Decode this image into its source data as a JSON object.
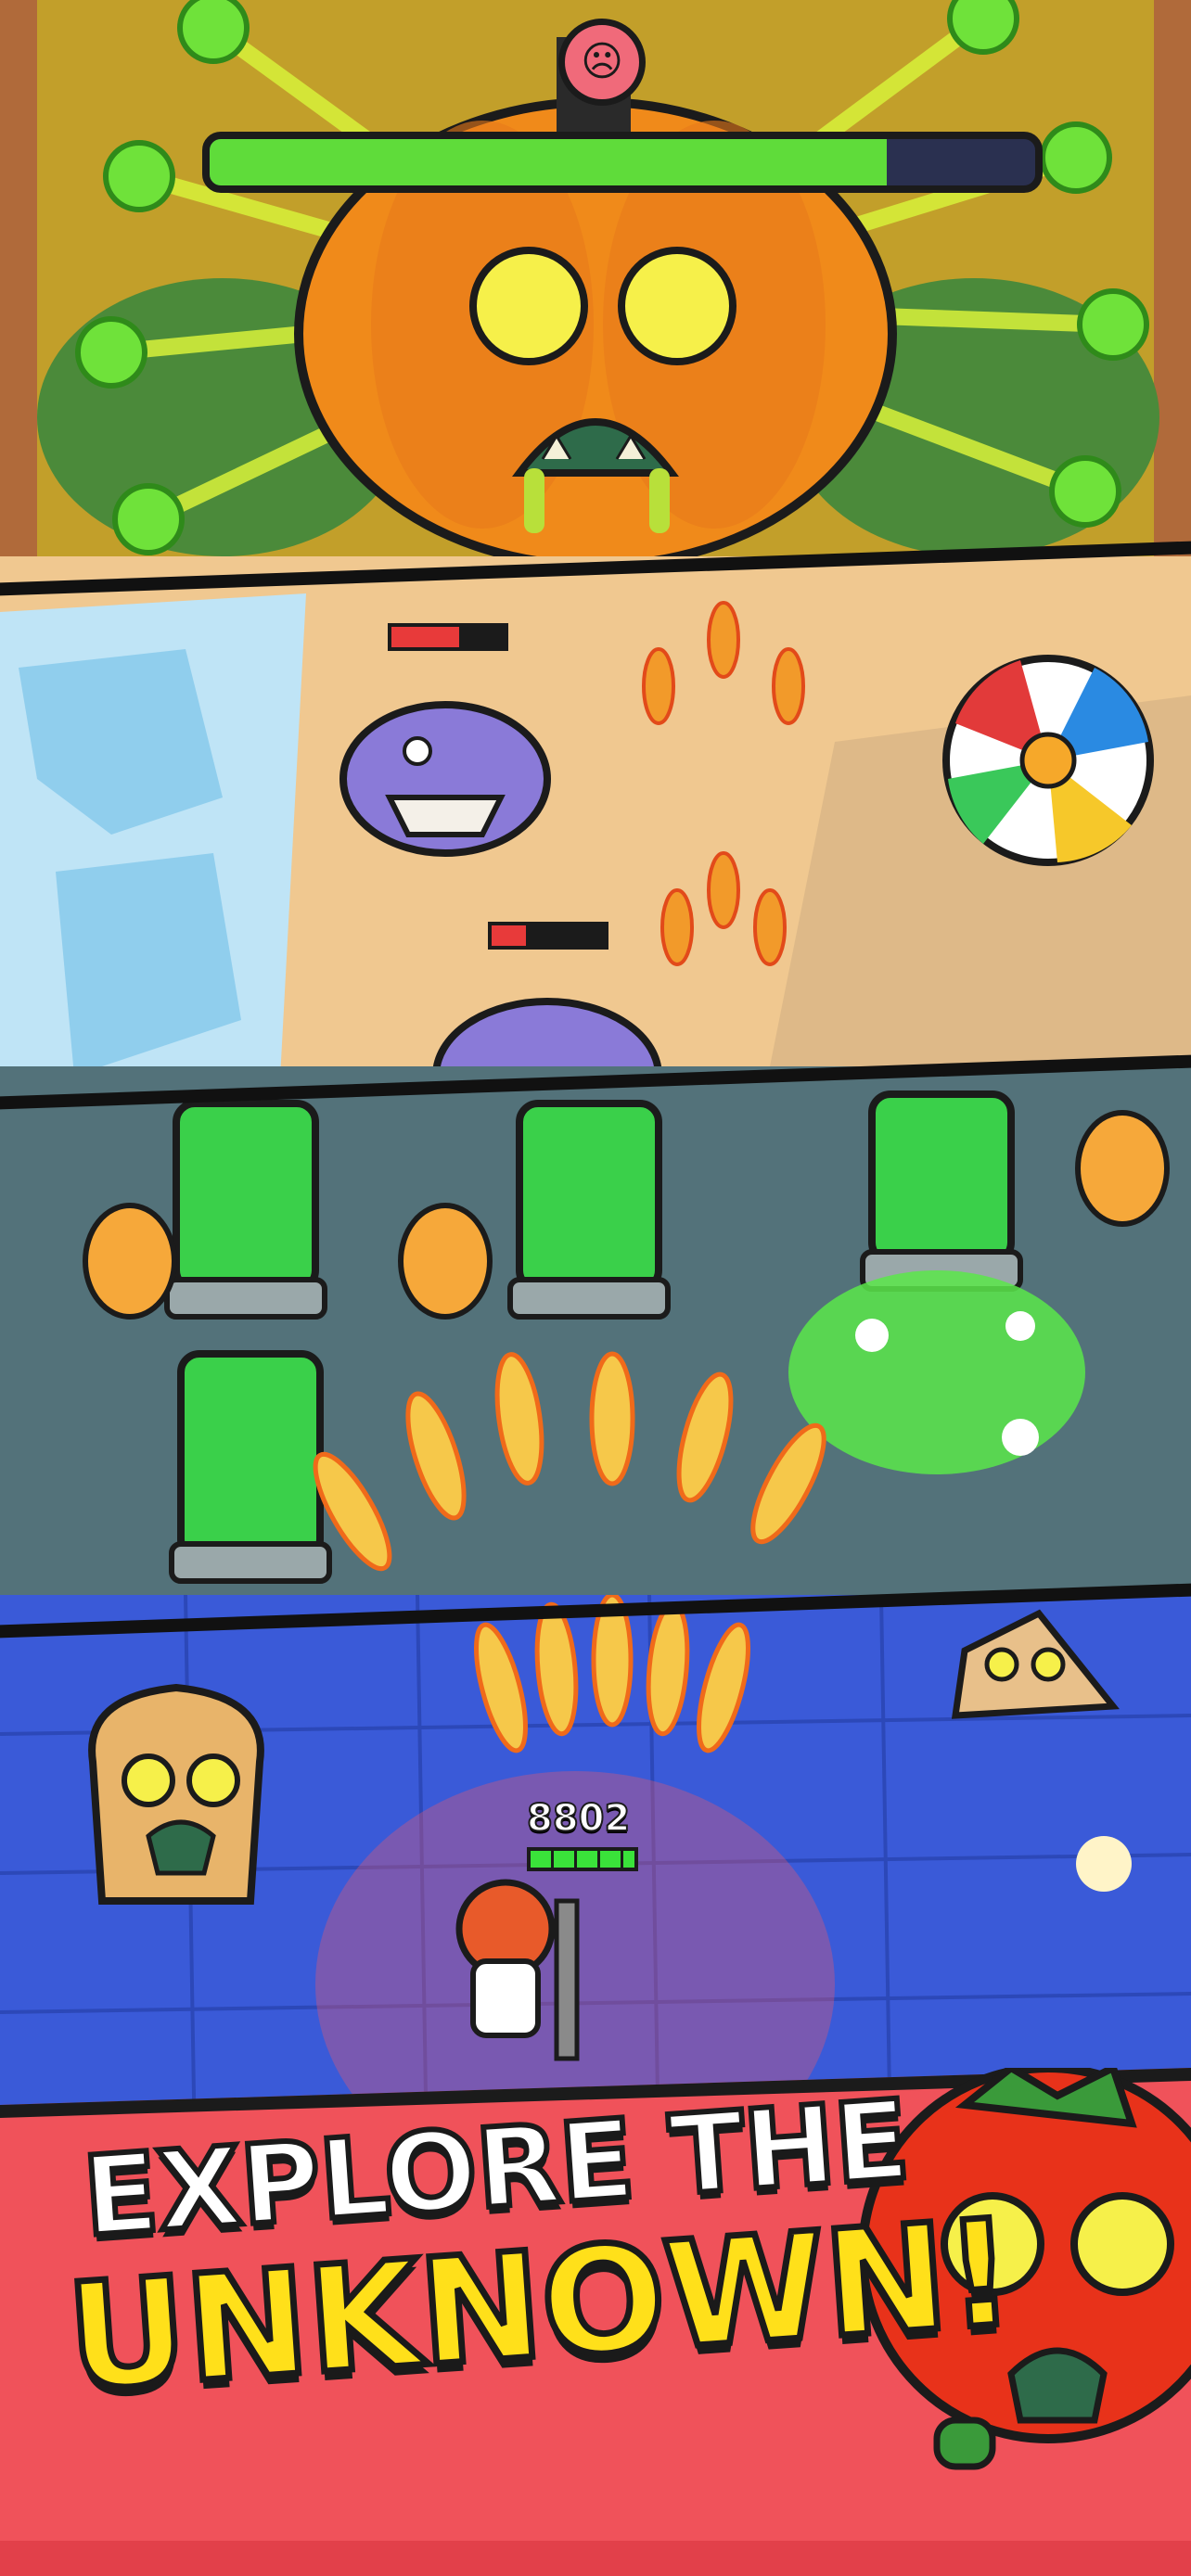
{
  "scenes": {
    "boss": {
      "boss_health_fraction": 0.82,
      "boss_name_icon": "angry-face-icon"
    },
    "beach": {
      "shark_top_health_fraction": 0.6,
      "shark_bottom_health_fraction": 0.3,
      "ball_icon": "beach-ball-icon"
    },
    "lab": {
      "enemy_icon": "zombie-icon"
    },
    "floor": {
      "player_score": "8802",
      "player_health_fraction": 1.0
    }
  },
  "banner": {
    "line1": "EXPLORE THE",
    "line2": "UNKNOWN!",
    "color_line1": "#ffffff",
    "color_line2": "#ffe01a",
    "color_background": "#f0525a"
  }
}
